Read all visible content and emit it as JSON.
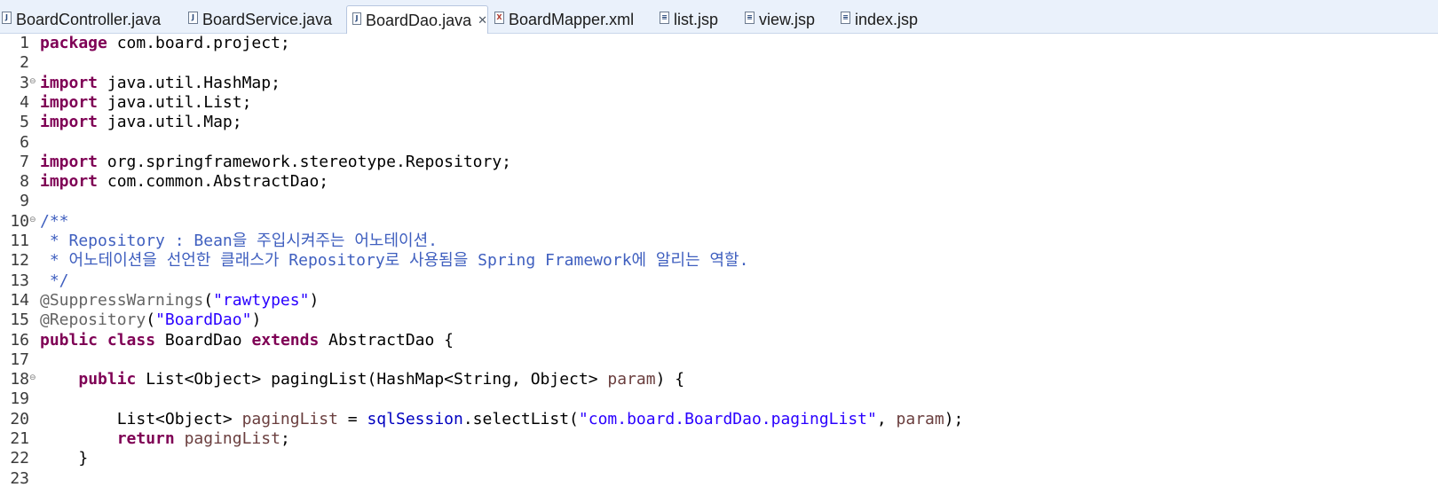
{
  "tabs": [
    {
      "label": "BoardController.java",
      "icon": "java-file-icon",
      "glyph": "J",
      "active": false
    },
    {
      "label": "BoardService.java",
      "icon": "java-file-icon",
      "glyph": "J",
      "active": false
    },
    {
      "label": "BoardDao.java",
      "icon": "java-file-icon",
      "glyph": "J",
      "active": true,
      "close": "✕"
    },
    {
      "label": "BoardMapper.xml",
      "icon": "xml-file-icon",
      "glyph": "X",
      "active": false
    },
    {
      "label": "list.jsp",
      "icon": "jsp-file-icon",
      "glyph": "≡",
      "active": false
    },
    {
      "label": "view.jsp",
      "icon": "jsp-file-icon",
      "glyph": "≡",
      "active": false
    },
    {
      "label": "index.jsp",
      "icon": "jsp-file-icon",
      "glyph": "≡",
      "active": false
    }
  ],
  "editor": {
    "fold_marker": "⊖",
    "lines": [
      {
        "n": "1",
        "fold": false,
        "tokens": [
          [
            "kw",
            "package"
          ],
          [
            "tx",
            " com.board.project;"
          ]
        ]
      },
      {
        "n": "2",
        "fold": false,
        "tokens": []
      },
      {
        "n": "3",
        "fold": true,
        "tokens": [
          [
            "kw",
            "import"
          ],
          [
            "tx",
            " java.util.HashMap;"
          ]
        ]
      },
      {
        "n": "4",
        "fold": false,
        "tokens": [
          [
            "kw",
            "import"
          ],
          [
            "tx",
            " java.util.List;"
          ]
        ]
      },
      {
        "n": "5",
        "fold": false,
        "tokens": [
          [
            "kw",
            "import"
          ],
          [
            "tx",
            " java.util.Map;"
          ]
        ]
      },
      {
        "n": "6",
        "fold": false,
        "tokens": []
      },
      {
        "n": "7",
        "fold": false,
        "tokens": [
          [
            "kw",
            "import"
          ],
          [
            "tx",
            " org.springframework.stereotype.Repository;"
          ]
        ]
      },
      {
        "n": "8",
        "fold": false,
        "tokens": [
          [
            "kw",
            "import"
          ],
          [
            "tx",
            " com.common.AbstractDao;"
          ]
        ]
      },
      {
        "n": "9",
        "fold": false,
        "tokens": []
      },
      {
        "n": "10",
        "fold": true,
        "tokens": [
          [
            "cm",
            "/**"
          ]
        ]
      },
      {
        "n": "11",
        "fold": false,
        "tokens": [
          [
            "cm",
            " * Repository : Bean을 주입시켜주는 어노테이션."
          ]
        ]
      },
      {
        "n": "12",
        "fold": false,
        "tokens": [
          [
            "cm",
            " * 어노테이션을 선언한 클래스가 Repository로 사용됨을 Spring Framework에 알리는 역할."
          ]
        ]
      },
      {
        "n": "13",
        "fold": false,
        "tokens": [
          [
            "cm",
            " */"
          ]
        ]
      },
      {
        "n": "14",
        "fold": false,
        "tokens": [
          [
            "an",
            "@SuppressWarnings"
          ],
          [
            "tx",
            "("
          ],
          [
            "st",
            "\"rawtypes\""
          ],
          [
            "tx",
            ")"
          ]
        ]
      },
      {
        "n": "15",
        "fold": false,
        "tokens": [
          [
            "an",
            "@Repository"
          ],
          [
            "tx",
            "("
          ],
          [
            "st",
            "\"BoardDao\""
          ],
          [
            "tx",
            ")"
          ]
        ]
      },
      {
        "n": "16",
        "fold": false,
        "tokens": [
          [
            "kw",
            "public"
          ],
          [
            "tx",
            " "
          ],
          [
            "kw",
            "class"
          ],
          [
            "tx",
            " BoardDao "
          ],
          [
            "kw",
            "extends"
          ],
          [
            "tx",
            " AbstractDao {"
          ]
        ]
      },
      {
        "n": "17",
        "fold": false,
        "tokens": []
      },
      {
        "n": "18",
        "fold": true,
        "tokens": [
          [
            "tx",
            "    "
          ],
          [
            "kw",
            "public"
          ],
          [
            "tx",
            " List<Object> pagingList(HashMap<String, Object> "
          ],
          [
            "pm",
            "param"
          ],
          [
            "tx",
            ") {"
          ]
        ]
      },
      {
        "n": "19",
        "fold": false,
        "tokens": []
      },
      {
        "n": "20",
        "fold": false,
        "tokens": [
          [
            "tx",
            "        List<Object> "
          ],
          [
            "pm",
            "pagingList"
          ],
          [
            "tx",
            " = "
          ],
          [
            "fd",
            "sqlSession"
          ],
          [
            "tx",
            ".selectList("
          ],
          [
            "st",
            "\"com.board.BoardDao.pagingList\""
          ],
          [
            "tx",
            ", "
          ],
          [
            "pm",
            "param"
          ],
          [
            "tx",
            ");"
          ]
        ]
      },
      {
        "n": "21",
        "fold": false,
        "tokens": [
          [
            "tx",
            "        "
          ],
          [
            "kw",
            "return"
          ],
          [
            "tx",
            " "
          ],
          [
            "pm",
            "pagingList"
          ],
          [
            "tx",
            ";"
          ]
        ]
      },
      {
        "n": "22",
        "fold": false,
        "tokens": [
          [
            "tx",
            "    }"
          ]
        ]
      },
      {
        "n": "23",
        "fold": false,
        "tokens": []
      }
    ]
  }
}
